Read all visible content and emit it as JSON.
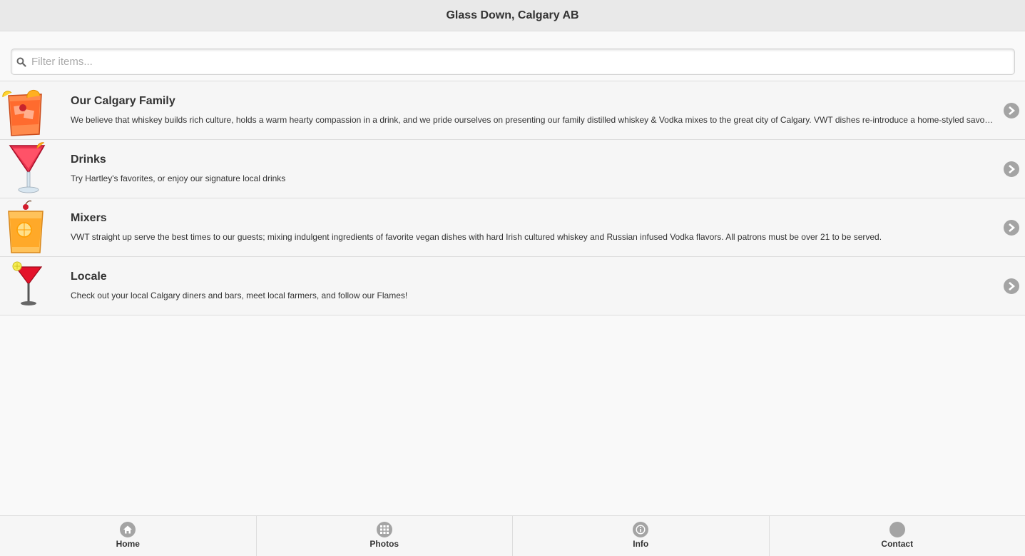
{
  "header": {
    "title": "Glass Down, Calgary AB"
  },
  "filter": {
    "placeholder": "Filter items...",
    "value": "",
    "icon": "search-icon"
  },
  "items": [
    {
      "title": "Our Calgary Family",
      "description": "We believe that whiskey builds rich culture, holds a warm hearty compassion in a drink, and we pride ourselves on presenting our family distilled whiskey & Vodka mixes to the great city of Calgary. VWT dishes re-introduce a home-styled savory touch to every day meals.",
      "icon": "old-fashioned-glass-icon"
    },
    {
      "title": "Drinks",
      "description": "Try Hartley's favorites, or enjoy our signature local drinks",
      "icon": "cosmopolitan-glass-icon"
    },
    {
      "title": "Mixers",
      "description": "VWT straight up serve the best times to our guests; mixing indulgent ingredients of favorite vegan dishes with hard Irish cultured whiskey and Russian infused Vodka flavors. All patrons must be over 21 to be served.",
      "icon": "orange-cocktail-glass-icon"
    },
    {
      "title": "Locale",
      "description": "Check out your local Calgary diners and bars, meet local farmers, and follow our Flames!",
      "icon": "martini-glass-icon"
    }
  ],
  "footer": {
    "tabs": [
      {
        "label": "Home",
        "icon": "home-icon"
      },
      {
        "label": "Photos",
        "icon": "grid-icon"
      },
      {
        "label": "Info",
        "icon": "info-icon"
      },
      {
        "label": "Contact",
        "icon": "contact-icon"
      }
    ]
  },
  "colors": {
    "header_bg": "#e9e9e9",
    "icon_gray": "#a4a4a4",
    "row_bg": "#f6f6f6"
  }
}
